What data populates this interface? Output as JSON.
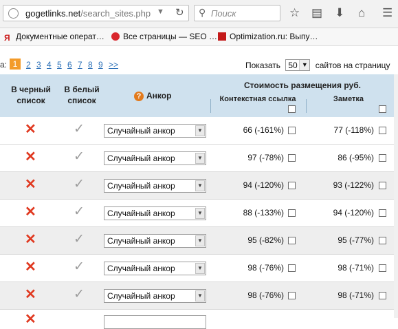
{
  "browser": {
    "host": "gogetlinks.net",
    "path": "/search_sites.php",
    "search_placeholder": "Поиск"
  },
  "bookmarks": [
    {
      "label": "Документные операт…",
      "icon": "yandex-icon",
      "color": "#cc1f1f"
    },
    {
      "label": "Все страницы — SEO …",
      "icon": "bookmark-icon",
      "color": "#d9262c"
    },
    {
      "label": "Optimization.ru: Выпу…",
      "icon": "optimization-icon",
      "color": "#c41a1a"
    }
  ],
  "pager": {
    "label": "а:",
    "pages": [
      "1",
      "2",
      "3",
      "4",
      "5",
      "6",
      "7",
      "8",
      "9",
      ">>"
    ],
    "active": "1",
    "perpage_label": "Показать",
    "perpage_value": "50",
    "perpage_suffix": "сайтов на страницу"
  },
  "table": {
    "headers": {
      "blacklist": "В черный список",
      "whitelist": "В белый список",
      "anchor": "Анкор",
      "cost": "Стоимость размещения руб.",
      "contextual": "Контекстная ссылка",
      "note": "Заметка"
    },
    "rows": [
      {
        "anchor": "Случайный анкор",
        "contextual": "66 (-161%)",
        "note": "77 (-118%)"
      },
      {
        "anchor": "Случайный анкор",
        "contextual": "97 (-78%)",
        "note": "86 (-95%)"
      },
      {
        "anchor": "Случайный анкор",
        "contextual": "94 (-120%)",
        "note": "93 (-122%)"
      },
      {
        "anchor": "Случайный анкор",
        "contextual": "88 (-133%)",
        "note": "94 (-120%)"
      },
      {
        "anchor": "Случайный анкор",
        "contextual": "95 (-82%)",
        "note": "95 (-77%)"
      },
      {
        "anchor": "Случайный анкор",
        "contextual": "98 (-76%)",
        "note": "98 (-71%)"
      },
      {
        "anchor": "Случайный анкор",
        "contextual": "98 (-76%)",
        "note": "98 (-71%)"
      }
    ]
  },
  "colors": {
    "accent_orange": "#f39b2a",
    "link_blue": "#2a6fb7",
    "header_bg": "#cfe1ee",
    "x_red": "#e0381f"
  }
}
